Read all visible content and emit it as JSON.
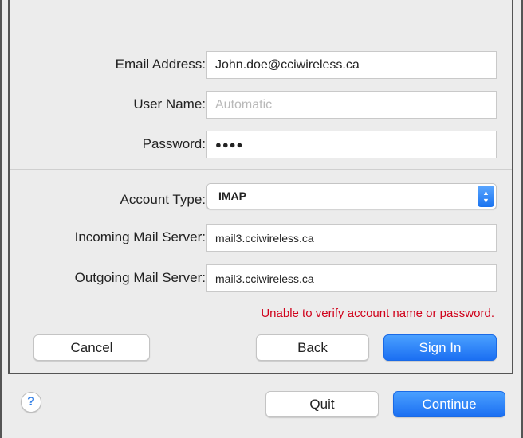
{
  "form": {
    "email_label": "Email Address:",
    "email_value": "John.doe@cciwireless.ca",
    "username_label": "User Name:",
    "username_placeholder": "Automatic",
    "password_label": "Password:",
    "password_value": "●●●●",
    "account_type_label": "Account Type:",
    "account_type_value": "IMAP",
    "incoming_label": "Incoming Mail Server:",
    "incoming_value": "mail3.cciwireless.ca",
    "outgoing_label": "Outgoing Mail Server:",
    "outgoing_value": "mail3.cciwireless.ca",
    "error_message": "Unable to verify account name or password."
  },
  "sheet_buttons": {
    "cancel": "Cancel",
    "back": "Back",
    "sign_in": "Sign In"
  },
  "footer": {
    "help": "?",
    "quit": "Quit",
    "continue": "Continue"
  },
  "colors": {
    "accent": "#1b6ff2",
    "error": "#d0021b"
  }
}
